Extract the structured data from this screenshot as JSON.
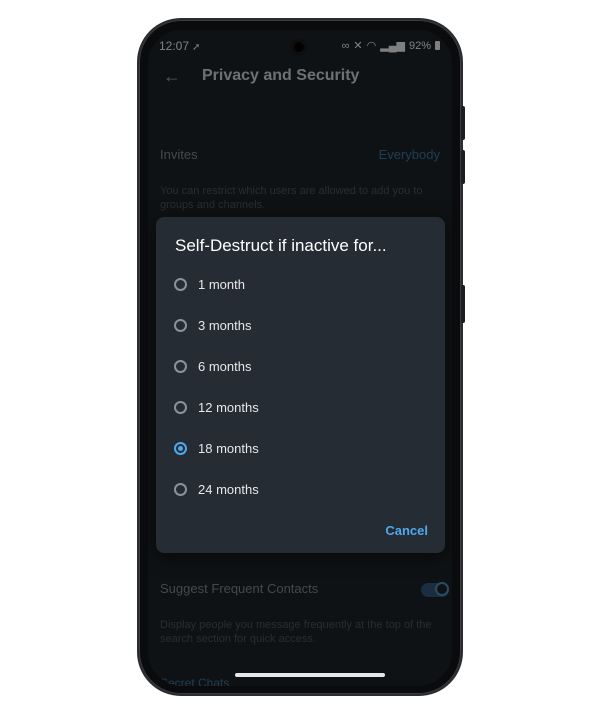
{
  "status_bar": {
    "time": "12:07",
    "battery": "92%",
    "icons": [
      "signal-arrow-icon",
      "infinity-icon",
      "mute-icon",
      "wifi-icon",
      "volte-icon",
      "cell-signal-icon",
      "battery-icon"
    ]
  },
  "app_bar": {
    "title": "Privacy and Security",
    "back_icon": "back-arrow-icon"
  },
  "settings": {
    "invites_label": "Invites",
    "invites_value": "Everybody",
    "invites_helper": "You can restrict which users are allowed to add you to groups and channels.",
    "suggest_label": "Suggest Frequent Contacts",
    "suggest_enabled": true,
    "suggest_helper": "Display people you message frequently at the top of the search section for quick access.",
    "secret_chats_header": "Secret Chats"
  },
  "dialog": {
    "title": "Self-Destruct if inactive for...",
    "options": [
      {
        "label": "1 month",
        "selected": false
      },
      {
        "label": "3 months",
        "selected": false
      },
      {
        "label": "6 months",
        "selected": false
      },
      {
        "label": "12 months",
        "selected": false
      },
      {
        "label": "18 months",
        "selected": true
      },
      {
        "label": "24 months",
        "selected": false
      }
    ],
    "cancel_label": "Cancel"
  },
  "colors": {
    "accent": "#4fa8ec",
    "dialog_bg": "#252c34",
    "screen_bg": "#1c2126"
  }
}
